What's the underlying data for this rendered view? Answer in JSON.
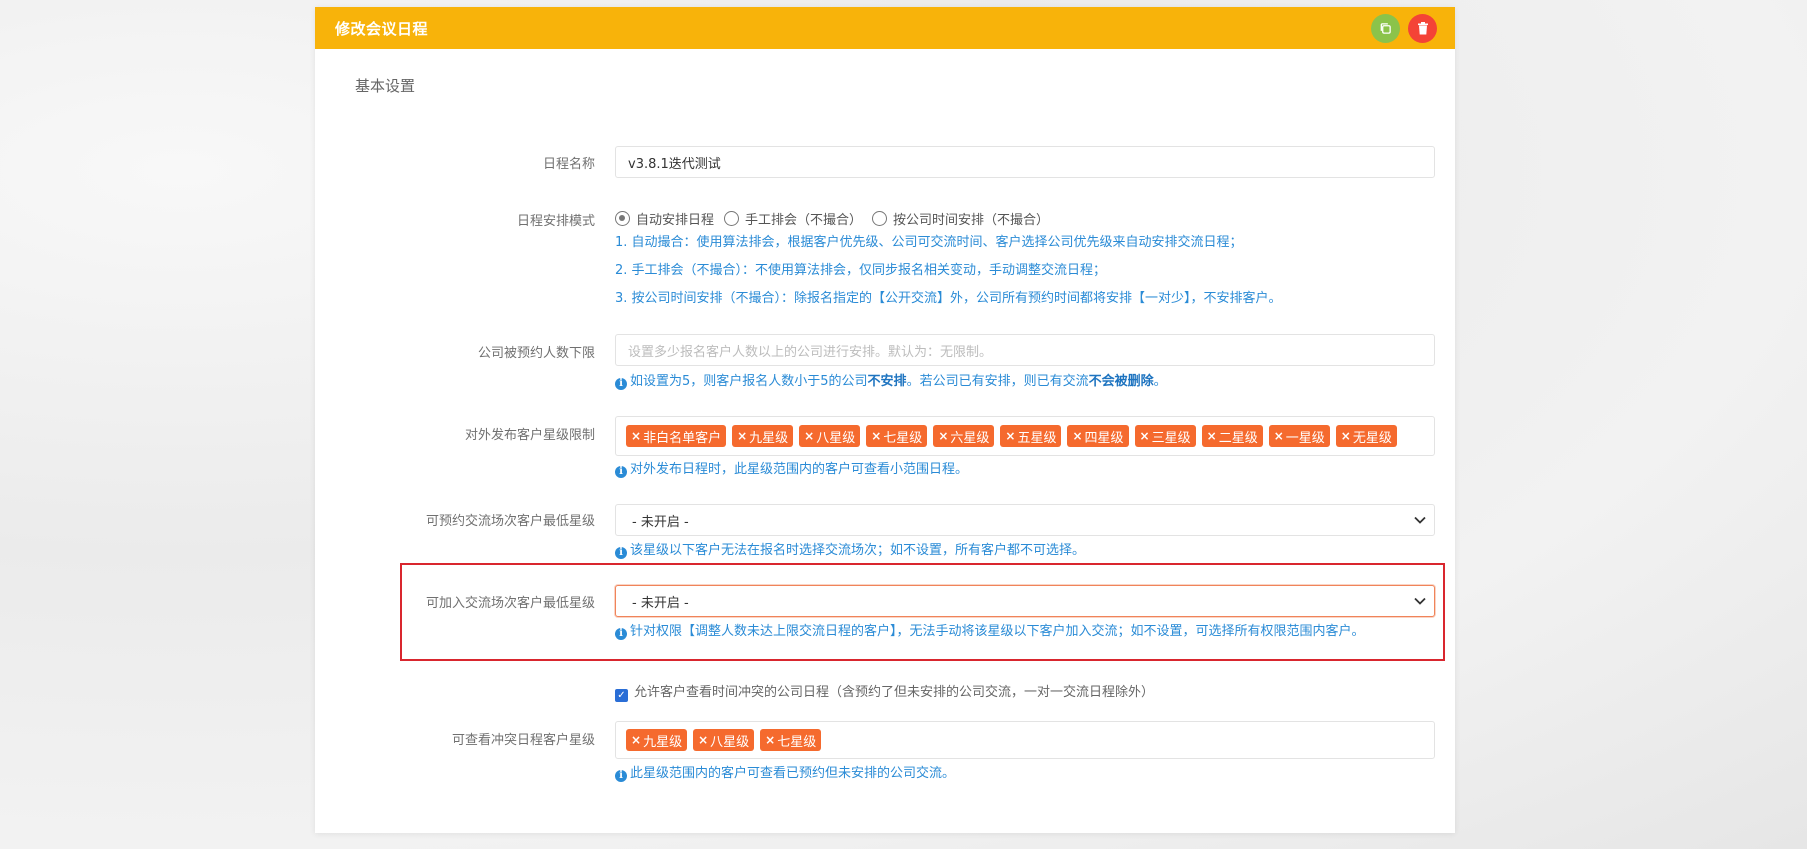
{
  "header": {
    "title": "修改会议日程",
    "copy_icon": "copy-icon",
    "delete_icon": "trash-icon"
  },
  "section_title": "基本设置",
  "schedule_name": {
    "label": "日程名称",
    "value": "v3.8.1迭代测试"
  },
  "schedule_mode": {
    "label": "日程安排模式",
    "options": [
      "自动安排日程",
      "手工排会（不撮合）",
      "按公司时间安排（不撮合）"
    ],
    "selected": "自动安排日程",
    "notes": [
      "1. 自动撮合：使用算法排会，根据客户优先级、公司可交流时间、客户选择公司优先级来自动安排交流日程；",
      "2. 手工排会（不撮合）：不使用算法排会，仅同步报名相关变动，手动调整交流日程；",
      "3. 按公司时间安排（不撮合）：除报名指定的【公开交流】外，公司所有预约时间都将安排【一对少】，不安排客户。"
    ]
  },
  "min_booking": {
    "label": "公司被预约人数下限",
    "placeholder": "设置多少报名客户人数以上的公司进行安排。默认为：无限制。",
    "help_pre": "如设置为5，则客户报名人数小于5的公司",
    "help_bold1": "不安排",
    "help_mid": "。若公司已有安排，则已有交流",
    "help_bold2": "不会被删除",
    "help_end": "。"
  },
  "publish_levels": {
    "label": "对外发布客户星级限制",
    "tags": [
      "非白名单客户",
      "九星级",
      "八星级",
      "七星级",
      "六星级",
      "五星级",
      "四星级",
      "三星级",
      "二星级",
      "一星级",
      "无星级"
    ],
    "help": "对外发布日程时，此星级范围内的客户可查看小范围日程。"
  },
  "bookable_min_level": {
    "label": "可预约交流场次客户最低星级",
    "value": "- 未开启 -",
    "help": "该星级以下客户无法在报名时选择交流场次；如不设置，所有客户都不可选择。"
  },
  "joinable_min_level": {
    "label": "可加入交流场次客户最低星级",
    "value": "- 未开启 -",
    "help": "针对权限【调整人数未达上限交流日程的客户】，无法手动将该星级以下客户加入交流；如不设置，可选择所有权限范围内客户。"
  },
  "allow_conflict": {
    "checked": true,
    "label": "允许客户查看时间冲突的公司日程（含预约了但未安排的公司交流，一对一交流日程除外）"
  },
  "conflict_levels": {
    "label": "可查看冲突日程客户星级",
    "tags": [
      "九星级",
      "八星级",
      "七星级"
    ],
    "help": "此星级范围内的客户可查看已预约但未安排的公司交流。"
  }
}
